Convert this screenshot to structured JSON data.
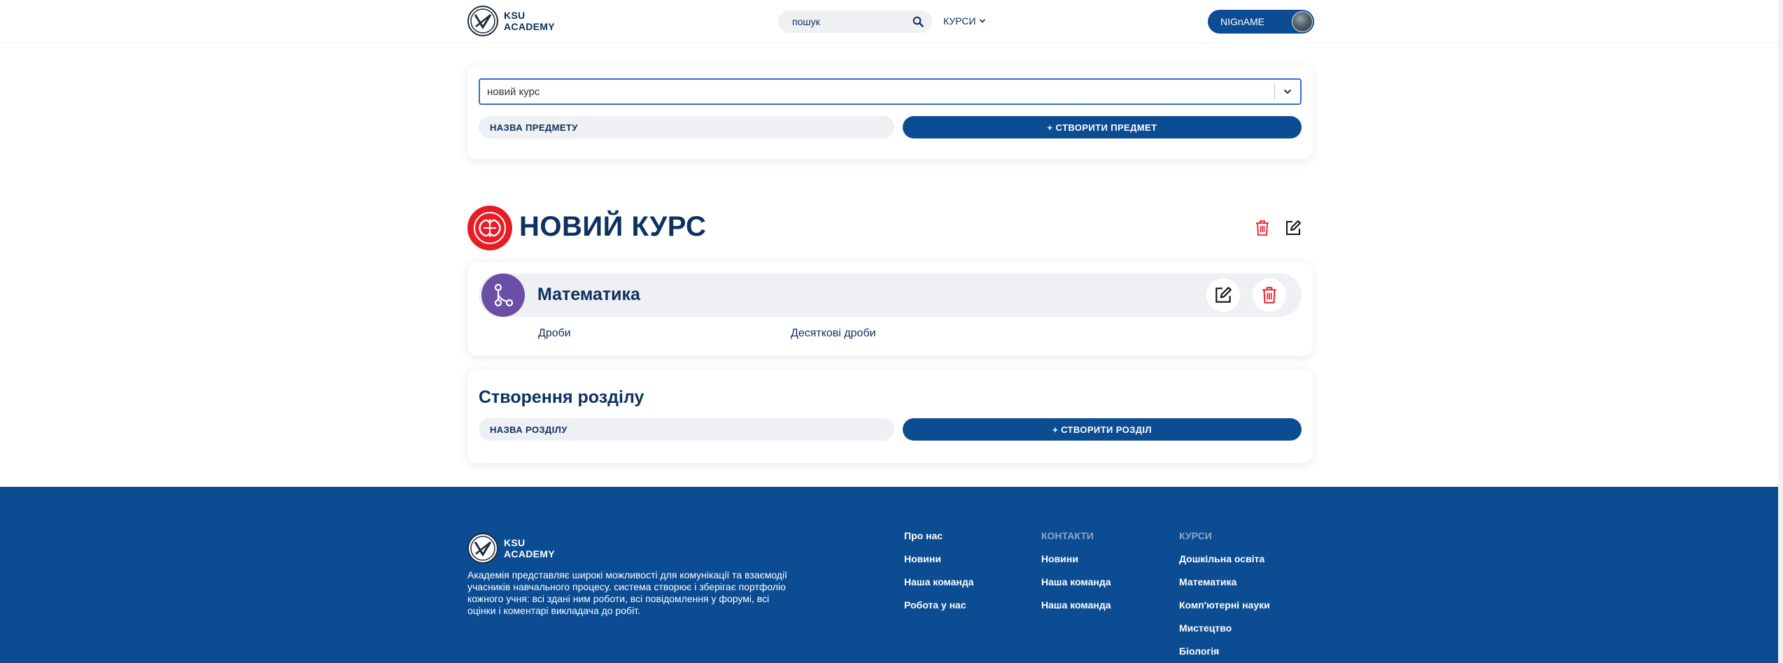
{
  "header": {
    "logo_line1": "KSU",
    "logo_line2": "ACADEMY",
    "search_placeholder": "пошук",
    "courses_label": "КУРСИ",
    "user_name": "NIGnAME"
  },
  "course_picker": {
    "selected_course": "новий курс",
    "subject_name_placeholder": "НАЗВА ПРЕДМЕТУ",
    "create_subject_label": "+ СТВОРИТИ ПРЕДМЕТ"
  },
  "course": {
    "title": "НОВИЙ КУРС"
  },
  "subject": {
    "name": "Математика",
    "sections": [
      "Дроби",
      "Десяткові дроби"
    ]
  },
  "create_section": {
    "heading": "Створення розділу",
    "section_name_placeholder": "НАЗВА РОЗДІЛУ",
    "create_section_label": "+ СТВОРИТИ РОЗДІЛ"
  },
  "footer": {
    "logo_line1": "KSU",
    "logo_line2": "ACADEMY",
    "description": "Академія представляє широкі можливості для комунікації та взаємодії учасників навчального процесу. система створює і зберігає портфоліо кожного учня: всі здані ним роботи, всі повідомлення у форумі, всі оцінки і коментарі викладача до робіт.",
    "col1": {
      "heading": "Про нас",
      "items": [
        "Новини",
        "Наша команда",
        "Робота у нас"
      ]
    },
    "col2": {
      "heading": "КОНТАКТИ",
      "items": [
        "Новини",
        "Наша команда",
        "Наша команда"
      ]
    },
    "col3": {
      "heading": "КУРСИ",
      "items": [
        "Дошкільна освіта",
        "Математика",
        "Комп'ютерні науки",
        "Мистецтво",
        "Біологія"
      ]
    }
  },
  "colors": {
    "brand_blue": "#0b4c93",
    "title_navy": "#0d3160",
    "danger_red": "#e81c24",
    "subject_purple": "#6b4fa7"
  },
  "icons": [
    "search-icon",
    "chevron-down-icon",
    "trash-icon",
    "edit-icon",
    "branch-icon"
  ]
}
